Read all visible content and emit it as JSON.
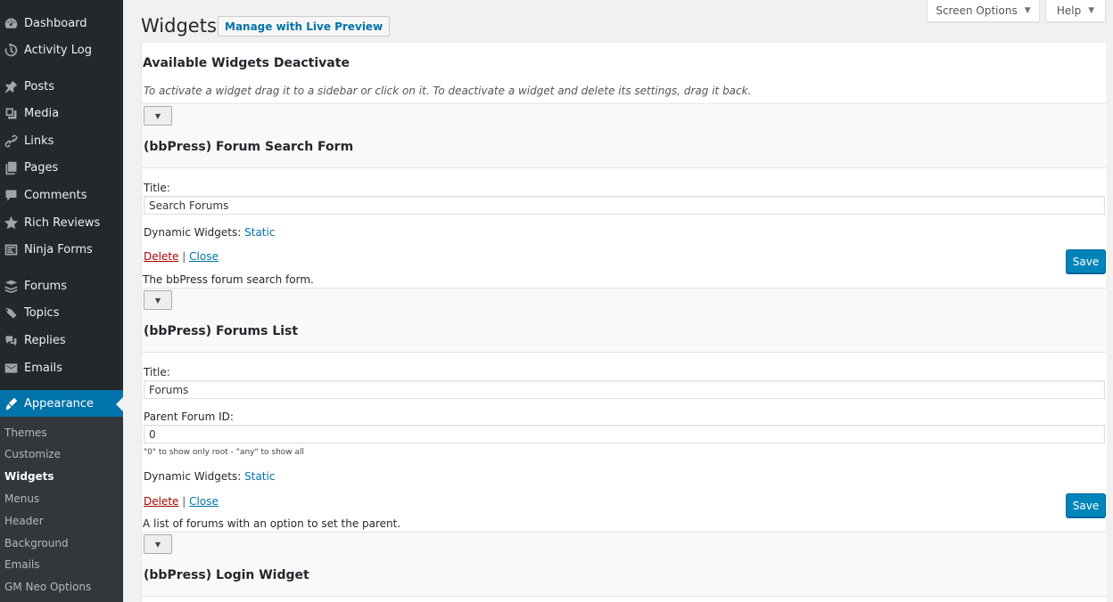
{
  "sidebar": {
    "items": [
      {
        "label": "Dashboard",
        "icon": "dashboard-icon"
      },
      {
        "label": "Activity Log",
        "icon": "history-icon"
      },
      {
        "label": "Posts",
        "icon": "pin-icon"
      },
      {
        "label": "Media",
        "icon": "media-icon"
      },
      {
        "label": "Links",
        "icon": "link-icon"
      },
      {
        "label": "Pages",
        "icon": "pages-icon"
      },
      {
        "label": "Comments",
        "icon": "comment-icon"
      },
      {
        "label": "Rich Reviews",
        "icon": "star-icon"
      },
      {
        "label": "Ninja Forms",
        "icon": "form-icon"
      },
      {
        "label": "Forums",
        "icon": "forums-icon"
      },
      {
        "label": "Topics",
        "icon": "topics-icon"
      },
      {
        "label": "Replies",
        "icon": "replies-icon"
      },
      {
        "label": "Emails",
        "icon": "email-icon"
      },
      {
        "label": "Appearance",
        "icon": "brush-icon"
      }
    ],
    "submenu": [
      "Themes",
      "Customize",
      "Widgets",
      "Menus",
      "Header",
      "Background",
      "Emails",
      "GM Neo Options"
    ]
  },
  "header": {
    "title": "Widgets",
    "live_preview": "Manage with Live Preview",
    "screen_options": "Screen Options",
    "help": "Help"
  },
  "available": {
    "heading": "Available Widgets Deactivate",
    "description": "To activate a widget drag it to a sidebar or click on it. To deactivate a widget and delete its settings, drag it back."
  },
  "widgets": [
    {
      "title": "(bbPress) Forum Search Form",
      "title_label": "Title:",
      "title_value": "Search Forums",
      "dynamic_label": "Dynamic Widgets:",
      "dynamic_value": "Static",
      "delete": "Delete",
      "separator": "|",
      "close": "Close",
      "save": "Save",
      "description": "The bbPress forum search form."
    },
    {
      "title": "(bbPress) Forums List",
      "title_label": "Title:",
      "title_value": "Forums",
      "parent_label": "Parent Forum ID:",
      "parent_value": "0",
      "parent_hint": "\"0\" to show only root - \"any\" to show all",
      "dynamic_label": "Dynamic Widgets:",
      "dynamic_value": "Static",
      "delete": "Delete",
      "separator": "|",
      "close": "Close",
      "save": "Save",
      "description": "A list of forums with an option to set the parent."
    },
    {
      "title": "(bbPress) Login Widget"
    }
  ],
  "colors": {
    "sidebar_bg": "#23282d",
    "submenu_bg": "#32373c",
    "accent": "#0073aa",
    "save_button": "#0085ba",
    "delete_link": "#aa0000"
  }
}
